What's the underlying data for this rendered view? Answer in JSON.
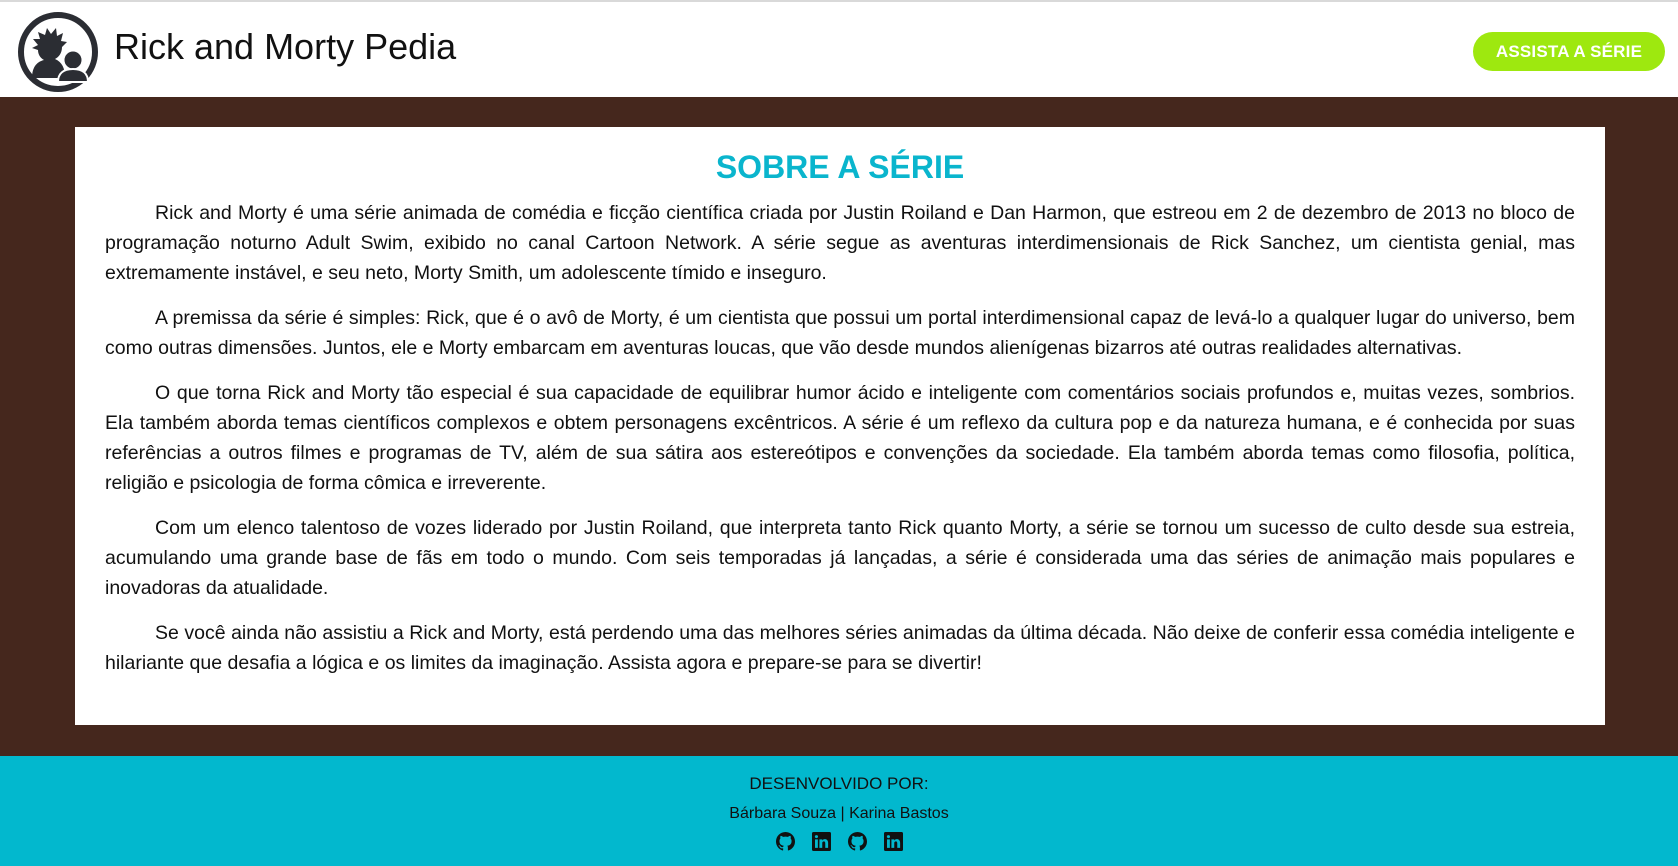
{
  "header": {
    "title": "Rick and Morty Pedia",
    "watch_button": "ASSISTA A SÉRIE",
    "logo_icon": "rick-and-morty-silhouette-icon"
  },
  "main": {
    "section_title": "SOBRE A SÉRIE",
    "paragraphs": [
      "Rick and Morty é uma série animada de comédia e ficção científica criada por Justin Roiland e Dan Harmon, que estreou em 2 de dezembro de 2013 no bloco de programação noturno Adult Swim, exibido no canal Cartoon Network. A série segue as aventuras interdimensionais de Rick Sanchez, um cientista genial, mas extremamente instável, e seu neto, Morty Smith, um adolescente tímido e inseguro.",
      "A premissa da série é simples: Rick, que é o avô de Morty, é um cientista que possui um portal interdimensional capaz de levá-lo a qualquer lugar do universo, bem como outras dimensões. Juntos, ele e Morty embarcam em aventuras loucas, que vão desde mundos alienígenas bizarros até outras realidades alternativas.",
      "O que torna Rick and Morty tão especial é sua capacidade de equilibrar humor ácido e inteligente com comentários sociais profundos e, muitas vezes, sombrios. Ela também aborda temas científicos complexos e obtem personagens excêntricos. A série é um reflexo da cultura pop e da natureza humana, e é conhecida por suas referências a outros filmes e programas de TV, além de sua sátira aos estereótipos e convenções da sociedade. Ela também aborda temas como filosofia, política, religião e psicologia de forma cômica e irreverente.",
      "Com um elenco talentoso de vozes liderado por Justin Roiland, que interpreta tanto Rick quanto Morty, a série se tornou um sucesso de culto desde sua estreia, acumulando uma grande base de fãs em todo o mundo. Com seis temporadas já lançadas, a série é considerada uma das séries de animação mais populares e inovadoras da atualidade.",
      "Se você ainda não assistiu a Rick and Morty, está perdendo uma das melhores séries animadas da última década. Não deixe de conferir essa comédia inteligente e hilariante que desafia a lógica e os limites da imaginação. Assista agora e prepare-se para se divertir!"
    ]
  },
  "footer": {
    "heading": "DESENVOLVIDO POR:",
    "credits": "Bárbara Souza | Karina Bastos",
    "icons": [
      "github-icon",
      "linkedin-icon",
      "github-icon",
      "linkedin-icon"
    ]
  },
  "colors": {
    "accent_green": "#9ee80f",
    "title_cyan": "#0ab5cd",
    "background_brown": "#45271d",
    "footer_cyan": "#02b8ce"
  }
}
